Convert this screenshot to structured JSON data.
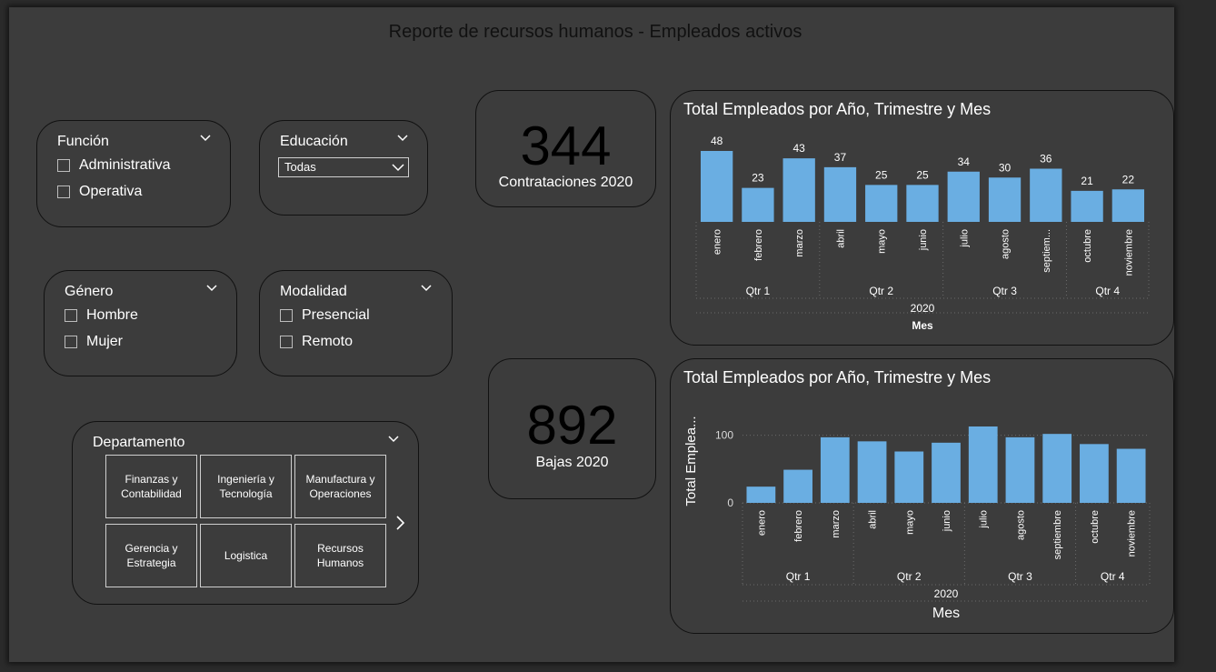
{
  "report": {
    "title": "Reporte de recursos humanos - Empleados activos"
  },
  "slicers": {
    "funcion": {
      "title": "Función",
      "options": [
        "Administrativa",
        "Operativa"
      ]
    },
    "educacion": {
      "title": "Educación",
      "selected": "Todas"
    },
    "genero": {
      "title": "Género",
      "options": [
        "Hombre",
        "Mujer"
      ]
    },
    "modalidad": {
      "title": "Modalidad",
      "options": [
        "Presencial",
        "Remoto"
      ]
    },
    "departamento": {
      "title": "Departamento",
      "tiles": [
        [
          "Finanzas y",
          "Contabilidad"
        ],
        [
          "Ingeniería y",
          "Tecnología"
        ],
        [
          "Manufactura y",
          "Operaciones"
        ],
        [
          "Gerencia y",
          "Estrategia"
        ],
        [
          "Logistica"
        ],
        [
          "Recursos",
          "Humanos"
        ]
      ]
    }
  },
  "kpis": {
    "contrataciones": {
      "value": "344",
      "label": "Contrataciones 2020"
    },
    "bajas": {
      "value": "892",
      "label": "Bajas 2020"
    }
  },
  "colors": {
    "bar": "#6aaee2",
    "card_bg": "#3c3c3c",
    "page_bg": "#2b2b2b"
  },
  "chart_data": [
    {
      "type": "bar",
      "title": "Total Empleados por Año, Trimestre y Mes",
      "categories": [
        "enero",
        "febrero",
        "marzo",
        "abril",
        "mayo",
        "junio",
        "julio",
        "agosto",
        "septiem...",
        "octubre",
        "noviembre"
      ],
      "values": [
        48,
        23,
        43,
        37,
        25,
        25,
        34,
        30,
        36,
        21,
        22
      ],
      "data_labels": true,
      "quarters": [
        {
          "label": "Qtr 1",
          "count": 3
        },
        {
          "label": "Qtr 2",
          "count": 3
        },
        {
          "label": "Qtr 3",
          "count": 3
        },
        {
          "label": "Qtr 4",
          "count": 2
        }
      ],
      "year": "2020",
      "xlabel": "Mes",
      "ylabel": "",
      "ylim": [
        0,
        48
      ]
    },
    {
      "type": "bar",
      "title": "Total Empleados por Año, Trimestre y Mes",
      "categories": [
        "enero",
        "febrero",
        "marzo",
        "abril",
        "mayo",
        "junio",
        "julio",
        "agosto",
        "septiembre",
        "octubre",
        "noviembre"
      ],
      "values": [
        24,
        49,
        97,
        91,
        76,
        89,
        113,
        97,
        102,
        87,
        80
      ],
      "yticks": [
        "0",
        "100"
      ],
      "quarters": [
        {
          "label": "Qtr 1",
          "count": 3
        },
        {
          "label": "Qtr 2",
          "count": 3
        },
        {
          "label": "Qtr 3",
          "count": 3
        },
        {
          "label": "Qtr 4",
          "count": 2
        }
      ],
      "year": "2020",
      "xlabel": "Mes",
      "ylabel": "Total Emplea...",
      "ylim": [
        0,
        113
      ]
    }
  ]
}
